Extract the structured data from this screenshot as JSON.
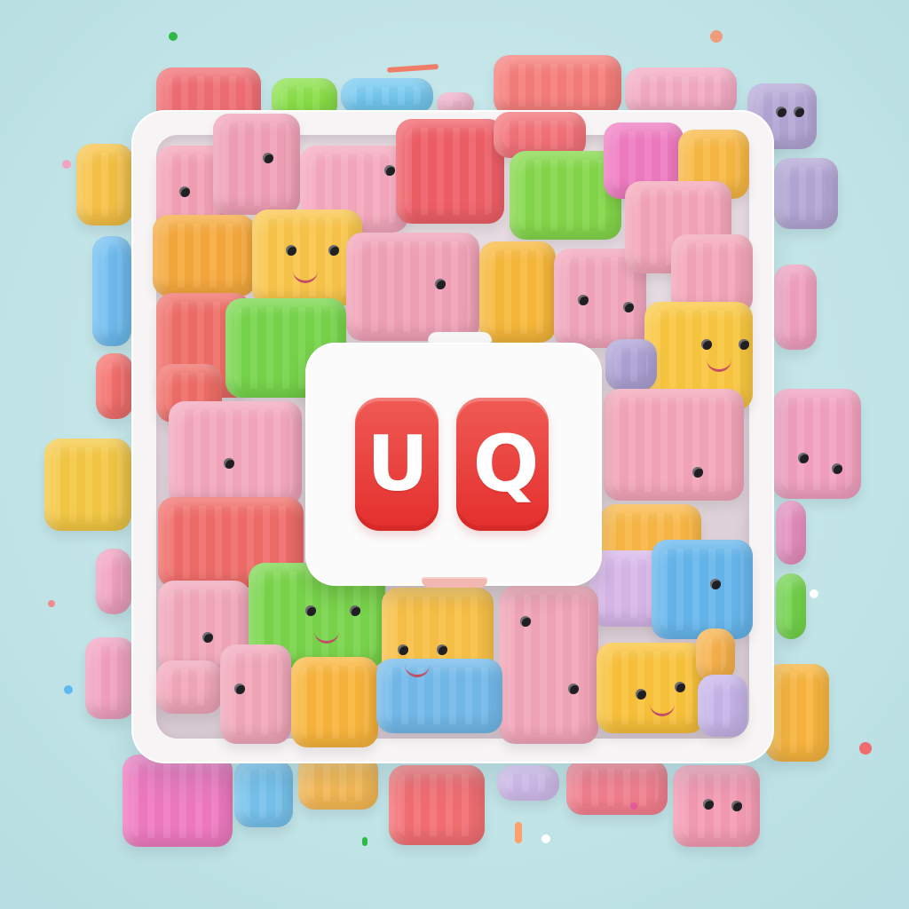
{
  "logo": {
    "left_glyph": "U",
    "right_glyph": "Q"
  },
  "colors": {
    "background": "#bfe3e6",
    "tray": "#f6f4f5",
    "logo_red": "#e32f2d"
  }
}
